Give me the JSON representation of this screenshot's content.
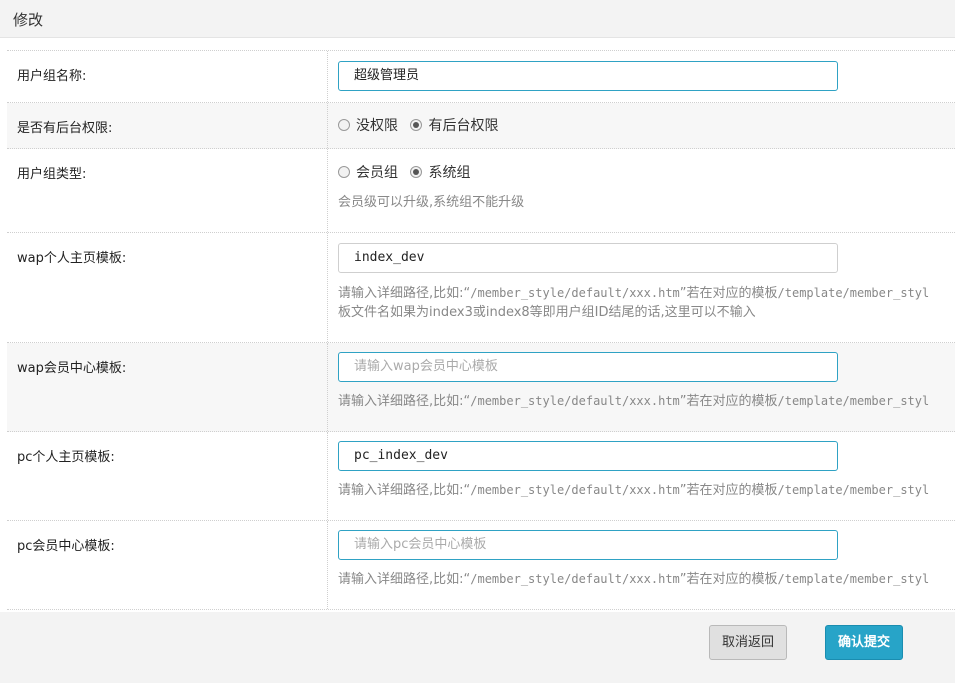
{
  "header": {
    "title": "修改"
  },
  "fields": {
    "group_name": {
      "label": "用户组名称:",
      "value": "超级管理员"
    },
    "admin_access": {
      "label": "是否有后台权限:",
      "options": [
        "没权限",
        "有后台权限"
      ],
      "selected": "有后台权限"
    },
    "group_type": {
      "label": "用户组类型:",
      "options": [
        "会员组",
        "系统组"
      ],
      "selected": "系统组",
      "hint": "会员级可以升级,系统组不能升级"
    },
    "wap_home_tpl": {
      "label": "wap个人主页模板:",
      "value": "index_dev",
      "hint_prefix": "请输入详细路径,比如:“",
      "hint_path": "/member_style/default/xxx.htm",
      "hint_mid": "”若在对应的模板",
      "hint_path2": "/template/member_styl",
      "hint_line2": "板文件名如果为index3或index8等即用户组ID结尾的话,这里可以不输入"
    },
    "wap_center_tpl": {
      "label": "wap会员中心模板:",
      "value": "",
      "placeholder": "请输入wap会员中心模板",
      "hint_prefix": "请输入详细路径,比如:“",
      "hint_path": "/member_style/default/xxx.htm",
      "hint_mid": "”若在对应的模板",
      "hint_path2": "/template/member_styl"
    },
    "pc_home_tpl": {
      "label": "pc个人主页模板:",
      "value": "pc_index_dev",
      "hint_prefix": "请输入详细路径,比如:“",
      "hint_path": "/member_style/default/xxx.htm",
      "hint_mid": "”若在对应的模板",
      "hint_path2": "/template/member_styl"
    },
    "pc_center_tpl": {
      "label": "pc会员中心模板:",
      "value": "",
      "placeholder": "请输入pc会员中心模板",
      "hint_prefix": "请输入详细路径,比如:“",
      "hint_path": "/member_style/default/xxx.htm",
      "hint_mid": "”若在对应的模板",
      "hint_path2": "/template/member_styl"
    }
  },
  "footer": {
    "cancel_label": "取消返回",
    "submit_label": "确认提交"
  },
  "colors": {
    "accent": "#27a4c8",
    "focus_border": "#2fa2c4"
  }
}
